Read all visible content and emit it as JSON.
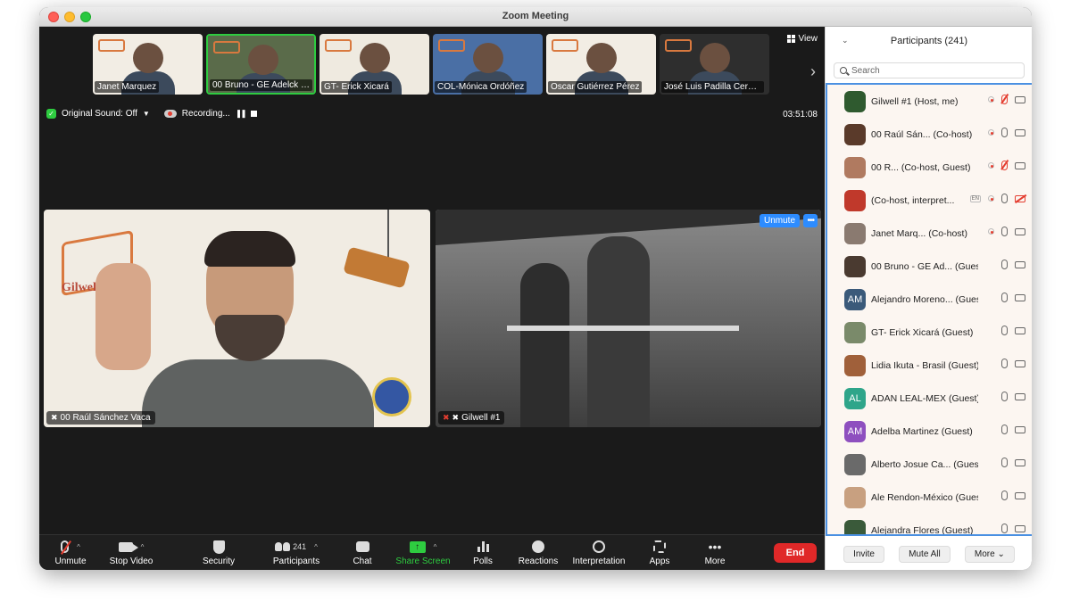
{
  "window": {
    "title": "Zoom Meeting"
  },
  "filmstrip": {
    "tiles": [
      {
        "name": "Janet Marquez",
        "bg": "#f2ede4"
      },
      {
        "name": "00 Bruno - GE Adelck Bi...",
        "bg": "#5a6b4a",
        "active": true
      },
      {
        "name": "GT- Erick Xicará",
        "bg": "#efeae0"
      },
      {
        "name": "COL-Mónica Ordóñez",
        "bg": "#4a6fa5"
      },
      {
        "name": "Oscar Gutiérrez Pérez",
        "bg": "#f2ede4"
      },
      {
        "name": "José Luis Padilla Cerezo...",
        "bg": "#2e2e2e"
      }
    ],
    "view_label": "View",
    "next_icon": "chevron-right-icon"
  },
  "status": {
    "original_sound": "Original Sound: Off",
    "recording": "Recording...",
    "timer": "03:51:08"
  },
  "main_videos": {
    "left_name": "00 Raúl Sánchez Vaca",
    "right_name": "Gilwell #1",
    "left_logo_text": "Gilwell",
    "unmute_label": "Unmute",
    "more_label": "•••"
  },
  "toolbar": {
    "unmute": "Unmute",
    "stop_video": "Stop Video",
    "security": "Security",
    "participants": "Participants",
    "participants_count": "241",
    "chat": "Chat",
    "share_screen": "Share Screen",
    "polls": "Polls",
    "reactions": "Reactions",
    "interpretation": "Interpretation",
    "apps": "Apps",
    "more": "More",
    "end": "End"
  },
  "panel": {
    "title": "Participants (241)",
    "search_placeholder": "Search",
    "participants": [
      {
        "name": "Gilwell #1 (Host, me)",
        "avatar_text": "",
        "avatar_color": "#2f5a2f",
        "rec": true,
        "lang": "",
        "mic_muted": true,
        "cam_muted": false
      },
      {
        "name": "00 Raúl Sán... (Co-host)",
        "avatar_text": "",
        "avatar_color": "#5a3a2a",
        "rec": true,
        "lang": "",
        "mic_muted": false,
        "cam_muted": false
      },
      {
        "name": "00 R... (Co-host, Guest)",
        "avatar_text": "",
        "avatar_color": "#b07a60",
        "rec": true,
        "lang": "",
        "mic_muted": true,
        "cam_muted": false
      },
      {
        "name": "(Co-host, interpret...",
        "avatar_text": "",
        "avatar_color": "#c0392b",
        "rec": true,
        "lang": "EN",
        "mic_muted": false,
        "cam_muted": true
      },
      {
        "name": "Janet Marq... (Co-host)",
        "avatar_text": "",
        "avatar_color": "#8a7a70",
        "rec": true,
        "lang": "",
        "mic_muted": false,
        "cam_muted": false
      },
      {
        "name": "00 Bruno - GE Ad... (Guest)",
        "avatar_text": "",
        "avatar_color": "#4a3a30",
        "rec": false,
        "lang": "",
        "mic_muted": false,
        "cam_muted": false
      },
      {
        "name": "Alejandro Moreno... (Guest)",
        "avatar_text": "AM",
        "avatar_color": "#3b5a7a",
        "rec": false,
        "lang": "",
        "mic_muted": false,
        "cam_muted": false
      },
      {
        "name": "GT- Erick Xicará (Guest)",
        "avatar_text": "",
        "avatar_color": "#7a8a6a",
        "rec": false,
        "lang": "",
        "mic_muted": false,
        "cam_muted": false
      },
      {
        "name": "Lidia Ikuta - Brasil (Guest)",
        "avatar_text": "",
        "avatar_color": "#a0603a",
        "rec": false,
        "lang": "",
        "mic_muted": false,
        "cam_muted": false
      },
      {
        "name": "ADAN LEAL-MEX (Guest)",
        "avatar_text": "AL",
        "avatar_color": "#2fa58a",
        "rec": false,
        "lang": "",
        "mic_muted": false,
        "cam_muted": false
      },
      {
        "name": "Adelba Martinez (Guest)",
        "avatar_text": "AM",
        "avatar_color": "#8e4fbf",
        "rec": false,
        "lang": "",
        "mic_muted": false,
        "cam_muted": false
      },
      {
        "name": "Alberto Josue Ca... (Guest)",
        "avatar_text": "",
        "avatar_color": "#6a6a6a",
        "rec": false,
        "lang": "",
        "mic_muted": false,
        "cam_muted": false
      },
      {
        "name": "Ale Rendon-México (Guest)",
        "avatar_text": "",
        "avatar_color": "#c8a080",
        "rec": false,
        "lang": "",
        "mic_muted": false,
        "cam_muted": false
      },
      {
        "name": "Alejandra Flores (Guest)",
        "avatar_text": "",
        "avatar_color": "#3a5a3a",
        "rec": false,
        "lang": "",
        "mic_muted": false,
        "cam_muted": false
      }
    ],
    "invite": "Invite",
    "mute_all": "Mute All",
    "more": "More"
  }
}
